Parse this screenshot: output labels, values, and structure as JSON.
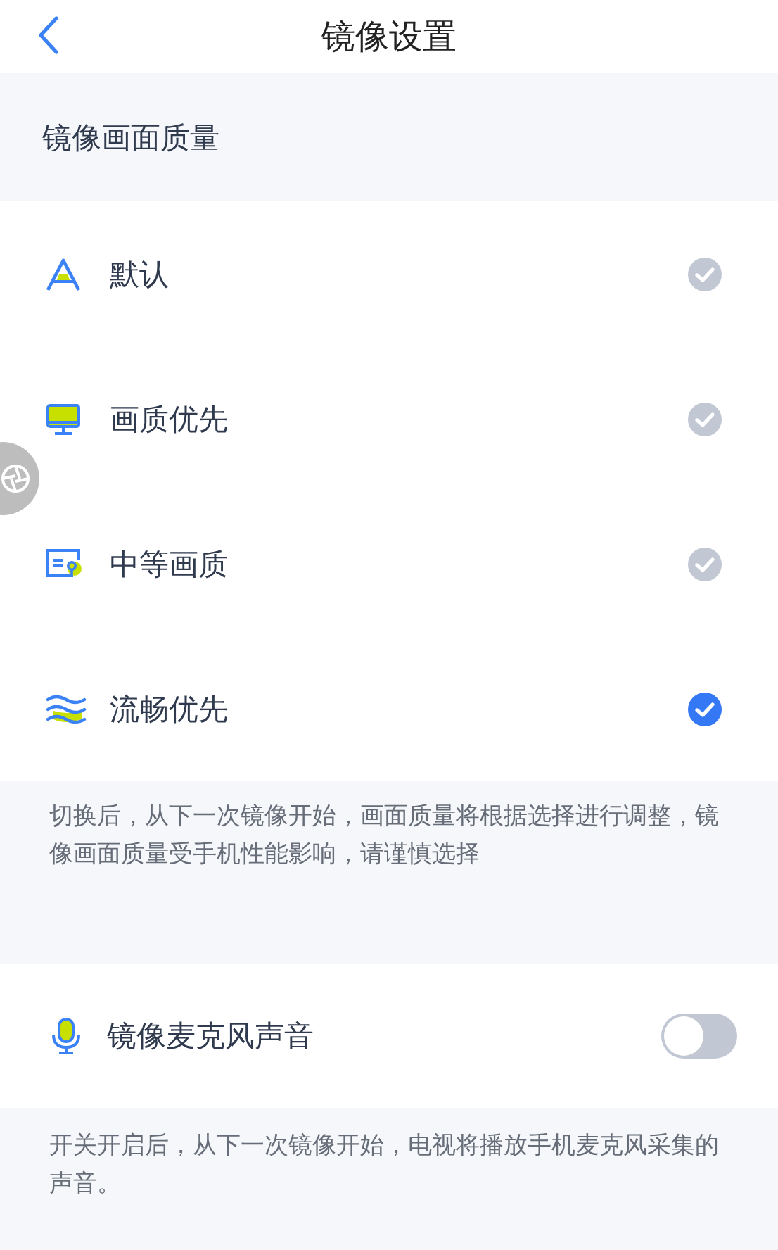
{
  "header": {
    "title": "镜像设置"
  },
  "quality_section": {
    "title": "镜像画面质量",
    "options": [
      {
        "kind": "default",
        "label": "默认",
        "selected": false
      },
      {
        "kind": "quality",
        "label": "画质优先",
        "selected": false
      },
      {
        "kind": "medium",
        "label": "中等画质",
        "selected": false
      },
      {
        "kind": "smooth",
        "label": "流畅优先",
        "selected": true
      }
    ],
    "note": "切换后，从下一次镜像开始，画面质量将根据选择进行调整，镜像画面质量受手机性能影响，请谨慎选择"
  },
  "microphone": {
    "label": "镜像麦克风声音",
    "on": false,
    "note": "开关开启后，从下一次镜像开始，电视将播放手机麦克风采集的声音。"
  }
}
